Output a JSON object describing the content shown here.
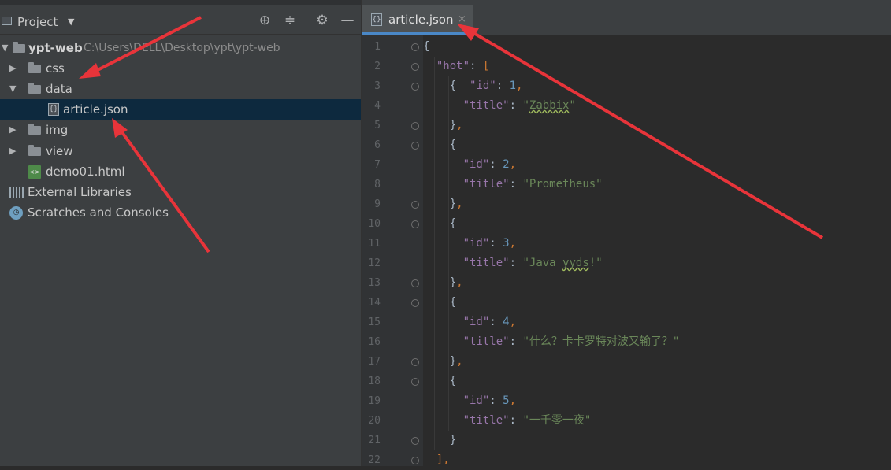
{
  "project_panel": {
    "title": "Project",
    "root": {
      "name": "ypt-web",
      "path": "C:\\Users\\DELL\\Desktop\\ypt\\ypt-web"
    },
    "items": [
      {
        "label": "css",
        "type": "folder",
        "expanded": false
      },
      {
        "label": "data",
        "type": "folder",
        "expanded": true
      },
      {
        "label": "article.json",
        "type": "json-file",
        "selected": true
      },
      {
        "label": "img",
        "type": "folder",
        "expanded": false
      },
      {
        "label": "view",
        "type": "folder",
        "expanded": false
      },
      {
        "label": "demo01.html",
        "type": "html-file"
      },
      {
        "label": "External Libraries",
        "type": "libraries"
      },
      {
        "label": "Scratches and Consoles",
        "type": "scratches"
      }
    ],
    "header_icons": [
      "locate-icon",
      "collapse-all-icon",
      "gear-icon",
      "hide-icon"
    ]
  },
  "editor": {
    "tab": {
      "label": "article.json",
      "close": "×"
    },
    "line_numbers": [
      "1",
      "2",
      "3",
      "4",
      "5",
      "6",
      "7",
      "8",
      "9",
      "10",
      "11",
      "12",
      "13",
      "14",
      "15",
      "16",
      "17",
      "18",
      "19",
      "20",
      "21",
      "22"
    ],
    "lines": [
      "{",
      "  \"hot\": [",
      "    {  \"id\": 1,",
      "      \"title\": \"Zabbix\"",
      "    },",
      "    {",
      "      \"id\": 2,",
      "      \"title\": \"Prometheus\"",
      "    },",
      "    {",
      "      \"id\": 3,",
      "      \"title\": \"Java yyds!\"",
      "    },",
      "    {",
      "      \"id\": 4,",
      "      \"title\": \"什么？卡卡罗特对波又输了？\"",
      "    },",
      "    {",
      "      \"id\": 5,",
      "      \"title\": \"一千零一夜\"",
      "    }",
      "  ],"
    ]
  },
  "colors": {
    "panel_bg": "#3c3f41",
    "editor_bg": "#2b2b2b",
    "selection": "#0d293e",
    "key": "#9876aa",
    "string": "#6a8759",
    "number": "#6897bb",
    "arrow": "#e8343a"
  }
}
